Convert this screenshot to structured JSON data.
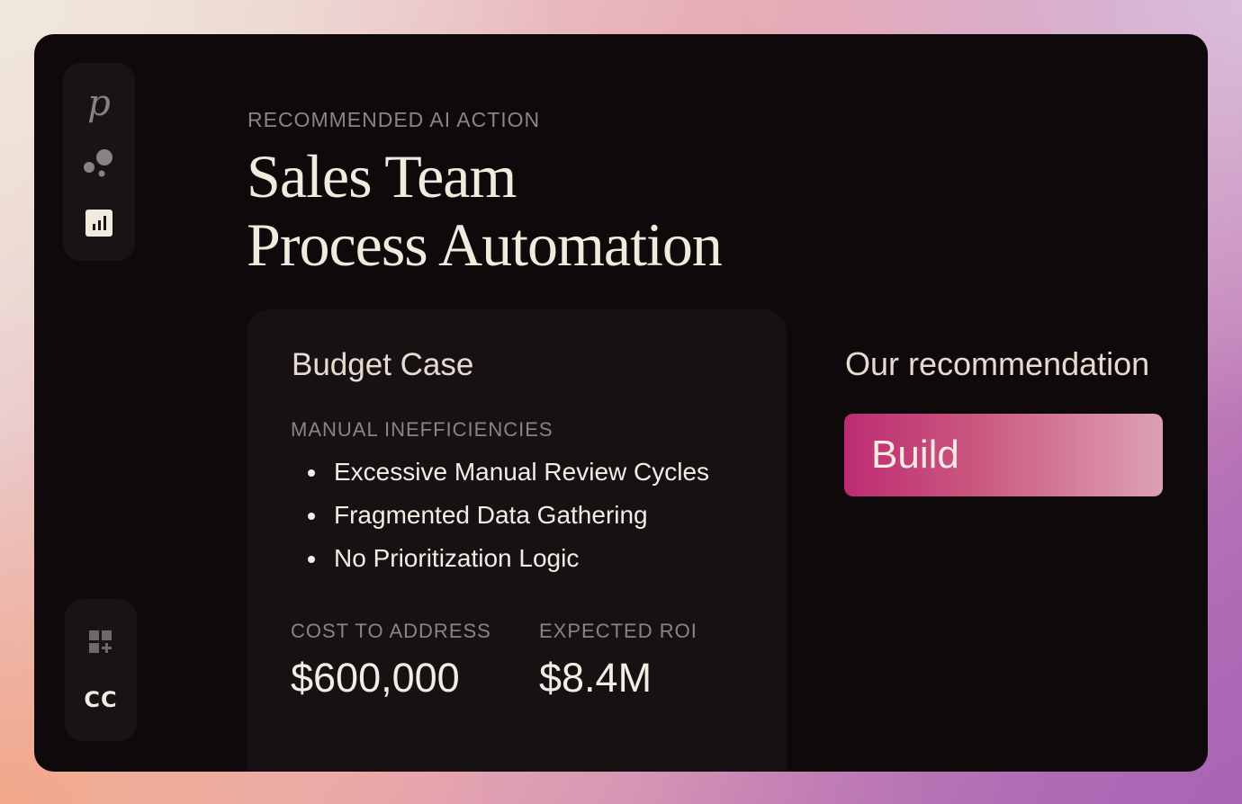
{
  "sidebar": {
    "logo": "p",
    "top_icons": [
      "bubbles-icon",
      "chart-icon"
    ],
    "bottom_icons": [
      "grid-add-icon"
    ],
    "user_initials": "CC"
  },
  "header": {
    "eyebrow": "RECOMMENDED AI ACTION",
    "title_line1": "Sales Team",
    "title_line2": "Process Automation"
  },
  "budget_case": {
    "title": "Budget Case",
    "inefficiencies_label": "MANUAL INEFFICIENCIES",
    "inefficiencies": [
      "Excessive Manual Review Cycles",
      "Fragmented Data Gathering",
      "No Prioritization Logic"
    ],
    "cost_label": "COST TO ADDRESS",
    "cost_value": "$600,000",
    "roi_label": "EXPECTED ROI",
    "roi_value": "$8.4M"
  },
  "recommendation": {
    "title": "Our recommendation",
    "action_label": "Build"
  },
  "colors": {
    "window_bg": "#0f090c",
    "card_bg": "#181114",
    "accent_start": "#bd2c71",
    "accent_end": "#dca0b5",
    "title_text": "#f1ebdd",
    "muted_text": "#8c8288"
  }
}
